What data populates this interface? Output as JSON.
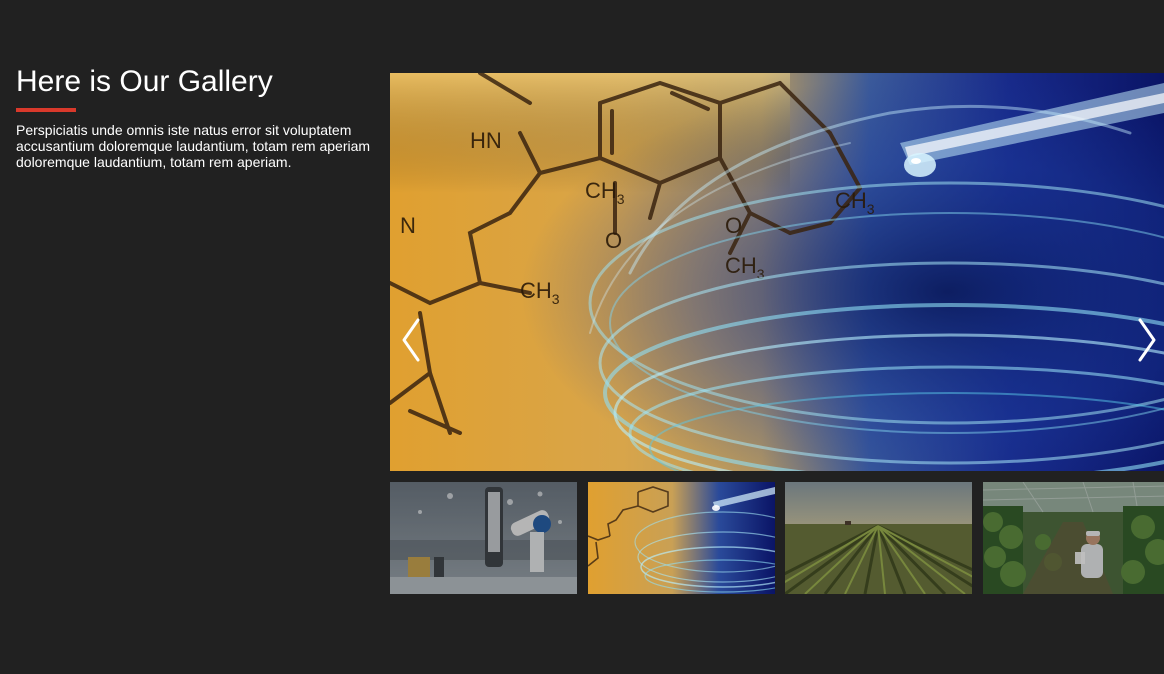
{
  "gallery": {
    "title": "Here is Our Gallery",
    "description": "Perspiciatis unde omnis iste natus error sit voluptatem accusantium doloremque laudantium, totam rem aperiam doloremque laudantium, totam rem aperiam.",
    "accent_color": "#d9392b",
    "background_color": "#212121",
    "main_image": {
      "subject": "chemistry molecule diagram with petri dish and pipette",
      "labels": [
        "CH3",
        "CH3",
        "CH3",
        "CH3",
        "O",
        "O",
        "N",
        "HN"
      ]
    },
    "navigation": {
      "prev_icon": "chevron-left-icon",
      "next_icon": "chevron-right-icon"
    },
    "thumbnails": [
      {
        "subject": "robotic arm in laboratory",
        "active": false
      },
      {
        "subject": "chemistry molecule with petri dish",
        "active": true
      },
      {
        "subject": "crop field rows",
        "active": false
      },
      {
        "subject": "greenhouse scientist with plants",
        "active": false
      }
    ]
  }
}
